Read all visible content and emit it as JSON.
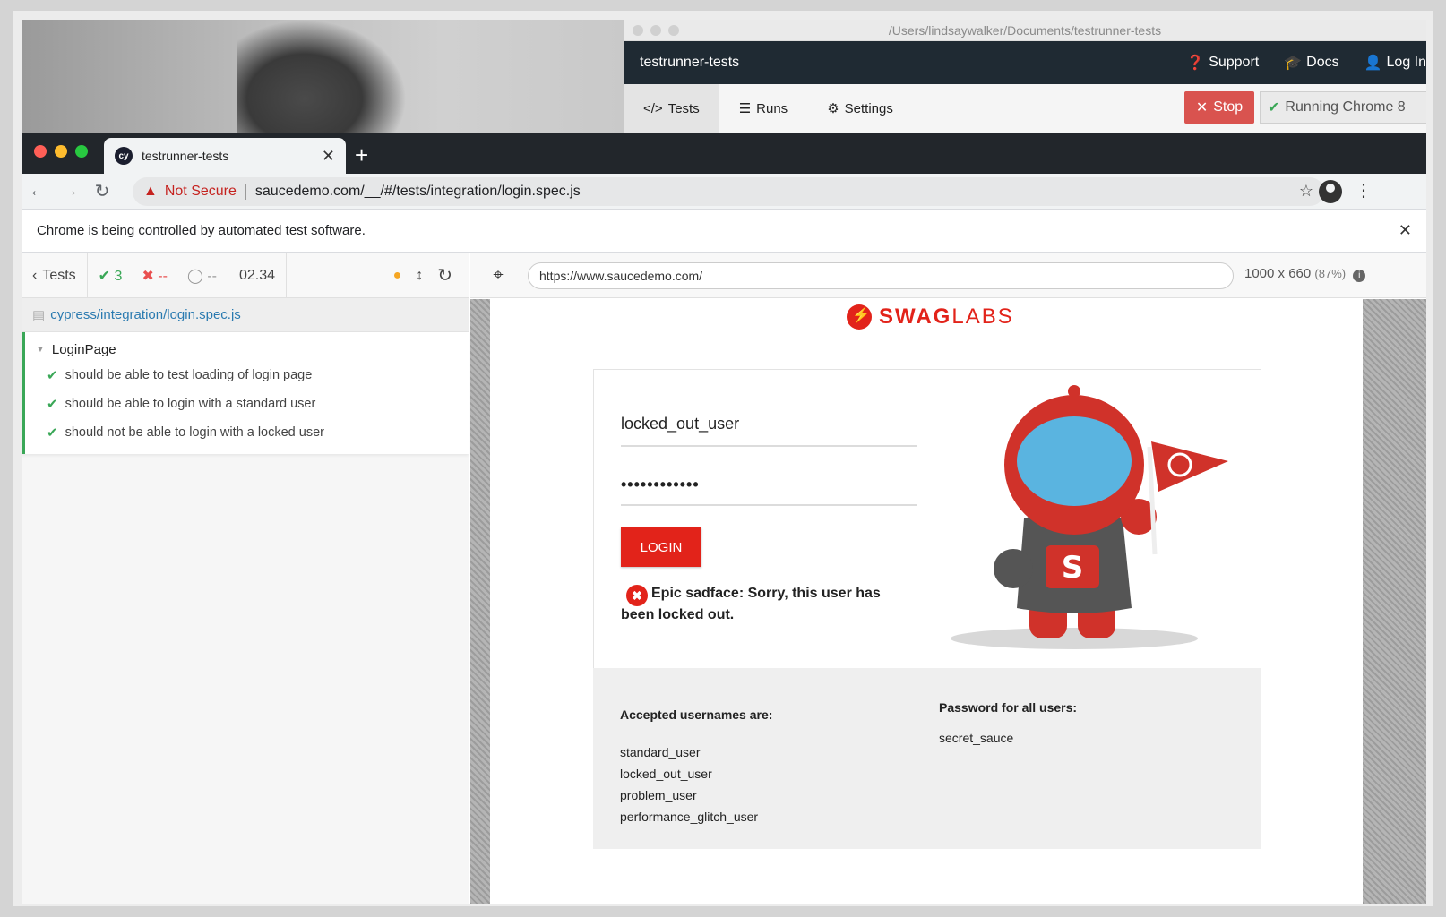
{
  "cypress_app": {
    "window_path": "/Users/lindsaywalker/Documents/testrunner-tests",
    "project_name": "testrunner-tests",
    "header_links": [
      "Support",
      "Docs",
      "Log In"
    ],
    "nav_tabs": [
      "Tests",
      "Runs",
      "Settings"
    ],
    "stop_label": "Stop",
    "running_label": "Running Chrome 8"
  },
  "chrome": {
    "tab_title": "testrunner-tests",
    "tab_favicon_text": "cy",
    "security_label": "Not Secure",
    "address": "saucedemo.com/__/#/tests/integration/login.spec.js",
    "infobar_text": "Chrome is being controlled by automated test software."
  },
  "runner": {
    "back_label": "Tests",
    "passed": "3",
    "failed": "--",
    "pending": "--",
    "duration": "02.34",
    "spec_path": "cypress/integration/login.spec.js",
    "suite": "LoginPage",
    "tests": [
      "should be able to test loading of login page",
      "should be able to login with a standard user",
      "should not be able to login with a locked user"
    ],
    "aut_url": "https://www.saucedemo.com/",
    "viewport": "1000 x 660",
    "scale": "(87%)"
  },
  "swaglabs": {
    "logo_left": "SWAG",
    "logo_right": "LABS",
    "username": "locked_out_user",
    "password_mask": "••••••••••••",
    "login_label": "LOGIN",
    "error_line1": "Epic sadface: Sorry, this user has",
    "error_line2": "been locked out.",
    "accepted_title": "Accepted usernames are:",
    "usernames": [
      "standard_user",
      "locked_out_user",
      "problem_user",
      "performance_glitch_user"
    ],
    "password_title": "Password for all users:",
    "password_value": "secret_sauce"
  },
  "colors": {
    "accent_red": "#e2231a",
    "pass_green": "#3aa757",
    "stop_red": "#d9534f",
    "header_dark": "#1f2a33"
  }
}
